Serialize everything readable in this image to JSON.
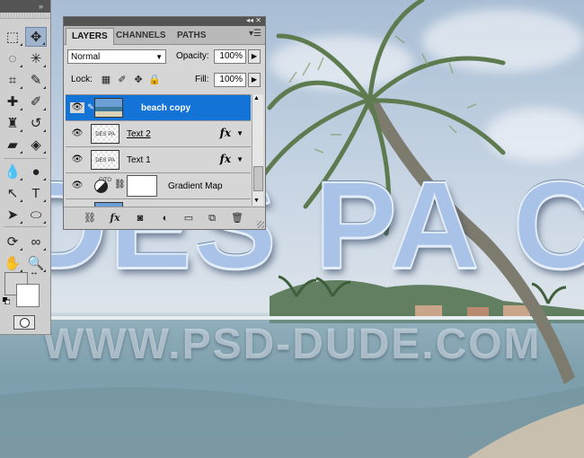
{
  "canvas": {
    "hero_text": "DES PA C",
    "watermark": "WWW.PSD-DUDE.COM"
  },
  "tools_panel": {
    "collapse_icon": "double-chevron",
    "tools": [
      {
        "name": "rectangular-marquee-tool",
        "glyph": "⬚"
      },
      {
        "name": "move-tool",
        "glyph": "✥",
        "selected": true
      },
      {
        "name": "lasso-tool",
        "glyph": "◌"
      },
      {
        "name": "magic-wand-tool",
        "glyph": "✳"
      },
      {
        "name": "crop-tool",
        "glyph": "⌗"
      },
      {
        "name": "eyedropper-tool",
        "glyph": "✎"
      },
      {
        "name": "healing-brush-tool",
        "glyph": "✚"
      },
      {
        "name": "brush-tool",
        "glyph": "✐"
      },
      {
        "name": "clone-stamp-tool",
        "glyph": "♜"
      },
      {
        "name": "history-brush-tool",
        "glyph": "↺"
      },
      {
        "name": "eraser-tool",
        "glyph": "▰"
      },
      {
        "name": "paint-bucket-tool",
        "glyph": "◈"
      },
      {
        "name": "blur-tool",
        "glyph": "💧"
      },
      {
        "name": "dodge-tool",
        "glyph": "●"
      },
      {
        "name": "path-selection-tool",
        "glyph": "↖"
      },
      {
        "name": "type-tool",
        "glyph": "T"
      },
      {
        "name": "direct-selection-tool",
        "glyph": "➤"
      },
      {
        "name": "ellipse-tool",
        "glyph": "⬭"
      },
      {
        "name": "3d-rotate-tool",
        "glyph": "⟳"
      },
      {
        "name": "3d-orbit-tool",
        "glyph": "∞"
      },
      {
        "name": "hand-tool",
        "glyph": "✋"
      },
      {
        "name": "zoom-tool",
        "glyph": "🔍"
      }
    ],
    "foreground_color": "#d4d4d4",
    "background_color": "#ffffff"
  },
  "layers_panel": {
    "tabs": [
      {
        "label": "LAYERS",
        "active": true
      },
      {
        "label": "CHANNELS",
        "active": false
      },
      {
        "label": "PATHS",
        "active": false
      }
    ],
    "blend_mode": "Normal",
    "opacity_label": "Opacity:",
    "opacity_value": "100%",
    "lock_label": "Lock:",
    "fill_label": "Fill:",
    "fill_value": "100%",
    "layers": [
      {
        "name": "beach copy",
        "selected": true,
        "thumb": "beach"
      },
      {
        "name": "Text 2",
        "selected": false,
        "thumb": "text",
        "fx": true
      },
      {
        "name": "Text 1",
        "selected": false,
        "thumb": "text",
        "fx": true
      },
      {
        "name": "Gradient Map",
        "selected": false,
        "thumb": "adjustment"
      }
    ],
    "fx_label": "fx",
    "text_thumb_label": "DES PA CITO",
    "accent_color": "#1473d6"
  }
}
